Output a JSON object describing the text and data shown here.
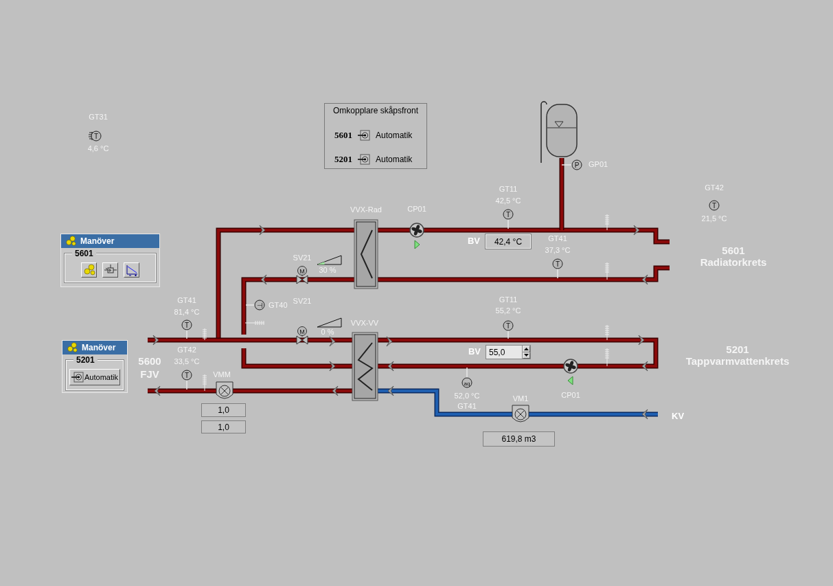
{
  "manover_panels": [
    {
      "title": "Manöver",
      "group": "5601",
      "buttons": [
        {
          "kind": "gears"
        },
        {
          "kind": "controller"
        },
        {
          "kind": "curve"
        }
      ]
    },
    {
      "title": "Manöver",
      "group": "5201",
      "buttons": [
        {
          "kind": "switch",
          "label": "Automatik"
        }
      ]
    }
  ],
  "switch_panel": {
    "title": "Omkopplare skåpsfront",
    "rows": [
      {
        "circuit": "5601",
        "mode": "Automatik"
      },
      {
        "circuit": "5201",
        "mode": "Automatik"
      }
    ]
  },
  "sensors": [
    {
      "label": "GT31",
      "reading": "4,6 °C",
      "symbol": "T"
    },
    {
      "label": "GP01",
      "symbol": "P"
    },
    {
      "label": "GT11",
      "reading": "42,5 °C",
      "symbol": "T"
    },
    {
      "label": "GT42",
      "reading": "21,5 °C",
      "symbol": "T"
    },
    {
      "label": "GT41",
      "reading": "37,3 °C",
      "symbol": "T"
    },
    {
      "label": "GT40",
      "symbol": "⊣"
    },
    {
      "label": "GT41",
      "reading": "81,4 °C",
      "symbol": "T"
    },
    {
      "label": "GT11",
      "reading": "55,2 °C",
      "symbol": "T"
    },
    {
      "label": "GT42",
      "reading": "33,5 °C",
      "symbol": "T"
    },
    {
      "label": "GT41",
      "reading": "52,0 °C",
      "symbol": "aq"
    }
  ],
  "valves": [
    {
      "label": "SV21",
      "symbol": "M",
      "level": 0.3,
      "reading": "30 %"
    },
    {
      "label": "SV21",
      "symbol": "M",
      "level": 0.0,
      "reading": "0 %"
    }
  ],
  "heat_exchangers": [
    {
      "label": "VVX-Rad"
    },
    {
      "label": "VVX-VV"
    }
  ],
  "pumps": [
    {
      "label": "CP01",
      "kind": "forward"
    },
    {
      "label": "CP01",
      "kind": "reverse"
    }
  ],
  "setpoints": [
    {
      "label": "BV",
      "kind": "display",
      "value": "42,4 °C"
    },
    {
      "label": "BV",
      "kind": "spinner",
      "value": "55,0"
    }
  ],
  "meters": [
    {
      "label": "VMM",
      "values": [
        "1,0",
        "1,0"
      ]
    },
    {
      "label": "VM1",
      "values": [
        "619,8 m3"
      ]
    }
  ],
  "circuits": [
    {
      "number": "5600",
      "name": "FJV"
    },
    {
      "number": "5601",
      "name": "Radiatorkrets"
    },
    {
      "number": "5201",
      "name": "Tappvarmvattenkrets"
    },
    {
      "name": "KV"
    }
  ]
}
